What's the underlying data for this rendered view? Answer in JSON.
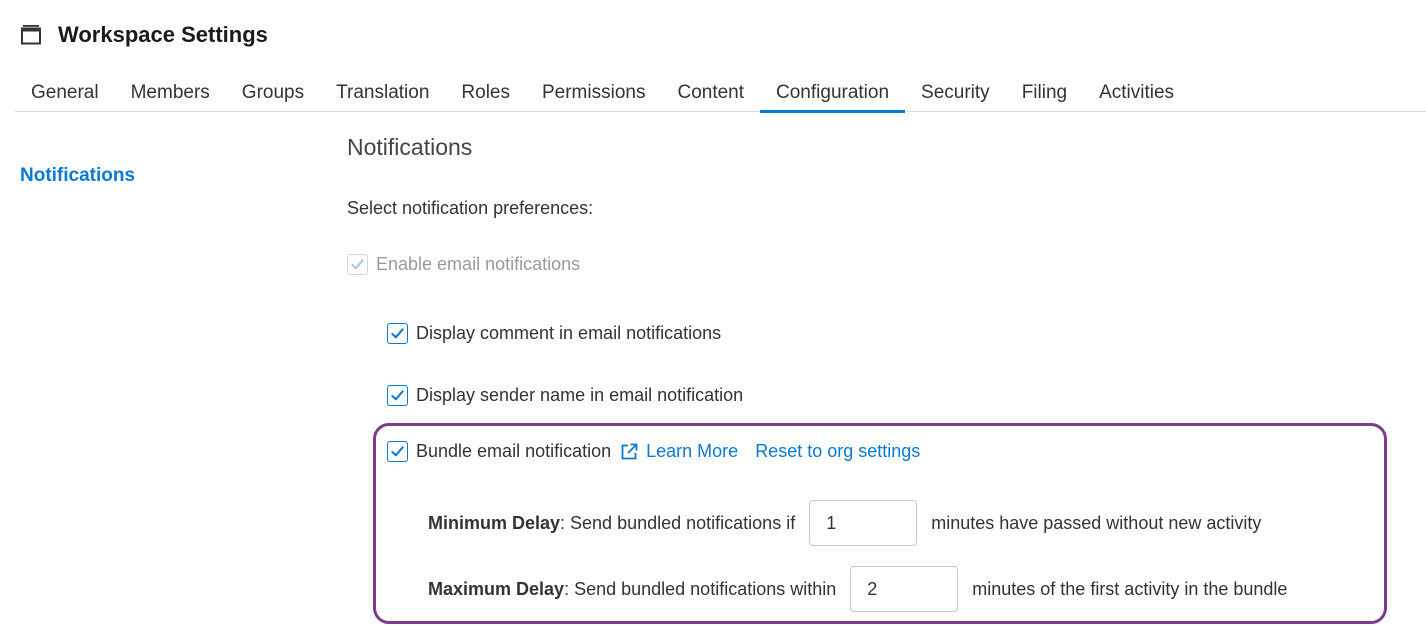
{
  "header": {
    "title": "Workspace Settings",
    "icon": "workspace-icon"
  },
  "tabs": [
    {
      "label": "General"
    },
    {
      "label": "Members"
    },
    {
      "label": "Groups"
    },
    {
      "label": "Translation"
    },
    {
      "label": "Roles"
    },
    {
      "label": "Permissions"
    },
    {
      "label": "Content"
    },
    {
      "label": "Configuration",
      "active": true
    },
    {
      "label": "Security"
    },
    {
      "label": "Filing"
    },
    {
      "label": "Activities"
    }
  ],
  "sidebar": {
    "items": [
      {
        "label": "Notifications",
        "active": true
      }
    ]
  },
  "notifications": {
    "title": "Notifications",
    "prefs_label": "Select notification preferences:",
    "enable_email": {
      "label": "Enable email notifications",
      "checked": true,
      "disabled": true
    },
    "display_comment": {
      "label": "Display comment in email notifications",
      "checked": true
    },
    "display_sender": {
      "label": "Display sender name in email notification",
      "checked": true
    },
    "bundle": {
      "label": "Bundle email notification",
      "checked": true,
      "learn_more": "Learn More",
      "reset": "Reset to org settings",
      "min_delay": {
        "label": "Minimum Delay",
        "prefix": ": Send bundled notifications if",
        "value": "1",
        "suffix": "minutes have passed without new activity"
      },
      "max_delay": {
        "label": "Maximum Delay",
        "prefix": ": Send bundled notifications within",
        "value": "2",
        "suffix": "minutes of the first activity in the bundle"
      }
    }
  },
  "colors": {
    "accent": "#0a79d1",
    "highlight_border": "#7b3b8e",
    "text": "#333333",
    "disabled_text": "#9a9a9a"
  }
}
